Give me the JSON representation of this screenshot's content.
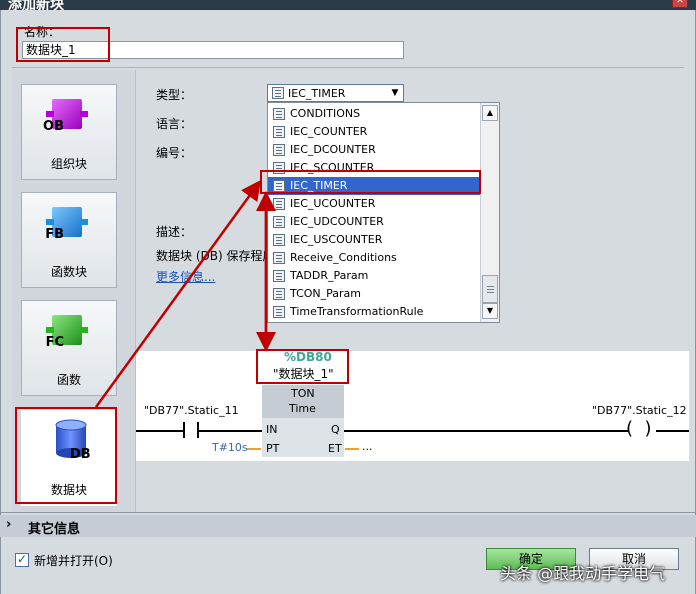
{
  "dialog": {
    "title": "添加新块",
    "name_label": "名称：",
    "name_value": "数据块_1"
  },
  "block_types": [
    {
      "label": "组织块",
      "tag": "OB",
      "color": "#b400d8"
    },
    {
      "label": "函数块",
      "tag": "FB",
      "color": "#1a8fe0"
    },
    {
      "label": "函数",
      "tag": "FC",
      "color": "#27b21e"
    },
    {
      "label": "数据块",
      "tag": "DB",
      "color": "#2e5fd6"
    }
  ],
  "form": {
    "type_label": "类型：",
    "language_label": "语言：",
    "number_label": "编号：",
    "description_label": "描述：",
    "retention_text": "数据块 (DB) 保存程序",
    "more_info_link": "更多信息..."
  },
  "type_combo": {
    "selected": "IEC_TIMER",
    "options": [
      "CONDITIONS",
      "IEC_COUNTER",
      "IEC_DCOUNTER",
      "IEC_SCOUNTER",
      "IEC_TIMER",
      "IEC_UCOUNTER",
      "IEC_UDCOUNTER",
      "IEC_USCOUNTER",
      "Receive_Conditions",
      "TADDR_Param",
      "TCON_Param",
      "TimeTransformationRule"
    ],
    "highlighted_index": 4
  },
  "ladder": {
    "db_number": "%DB80",
    "db_name": "\"数据块_1\"",
    "left_contact": "\"DB77\".Static_11",
    "right_coil": "\"DB77\".Static_12",
    "timer_type": "TON",
    "timer_subtype": "Time",
    "pin_in": "IN",
    "pin_q": "Q",
    "pin_pt": "PT",
    "pin_et": "ET",
    "pt_value": "T#10s",
    "et_value": "..."
  },
  "footer": {
    "other_info": "其它信息",
    "checkbox_label": "新增并打开(O)",
    "checkbox_checked": true,
    "ok_button": "确定",
    "cancel_button": "取消",
    "watermark": "头条 @跟我动手学电气"
  },
  "colors": {
    "annotation_red": "#c00000",
    "selection_blue": "#3366cc",
    "db_tag_teal": "#3aa89e"
  }
}
